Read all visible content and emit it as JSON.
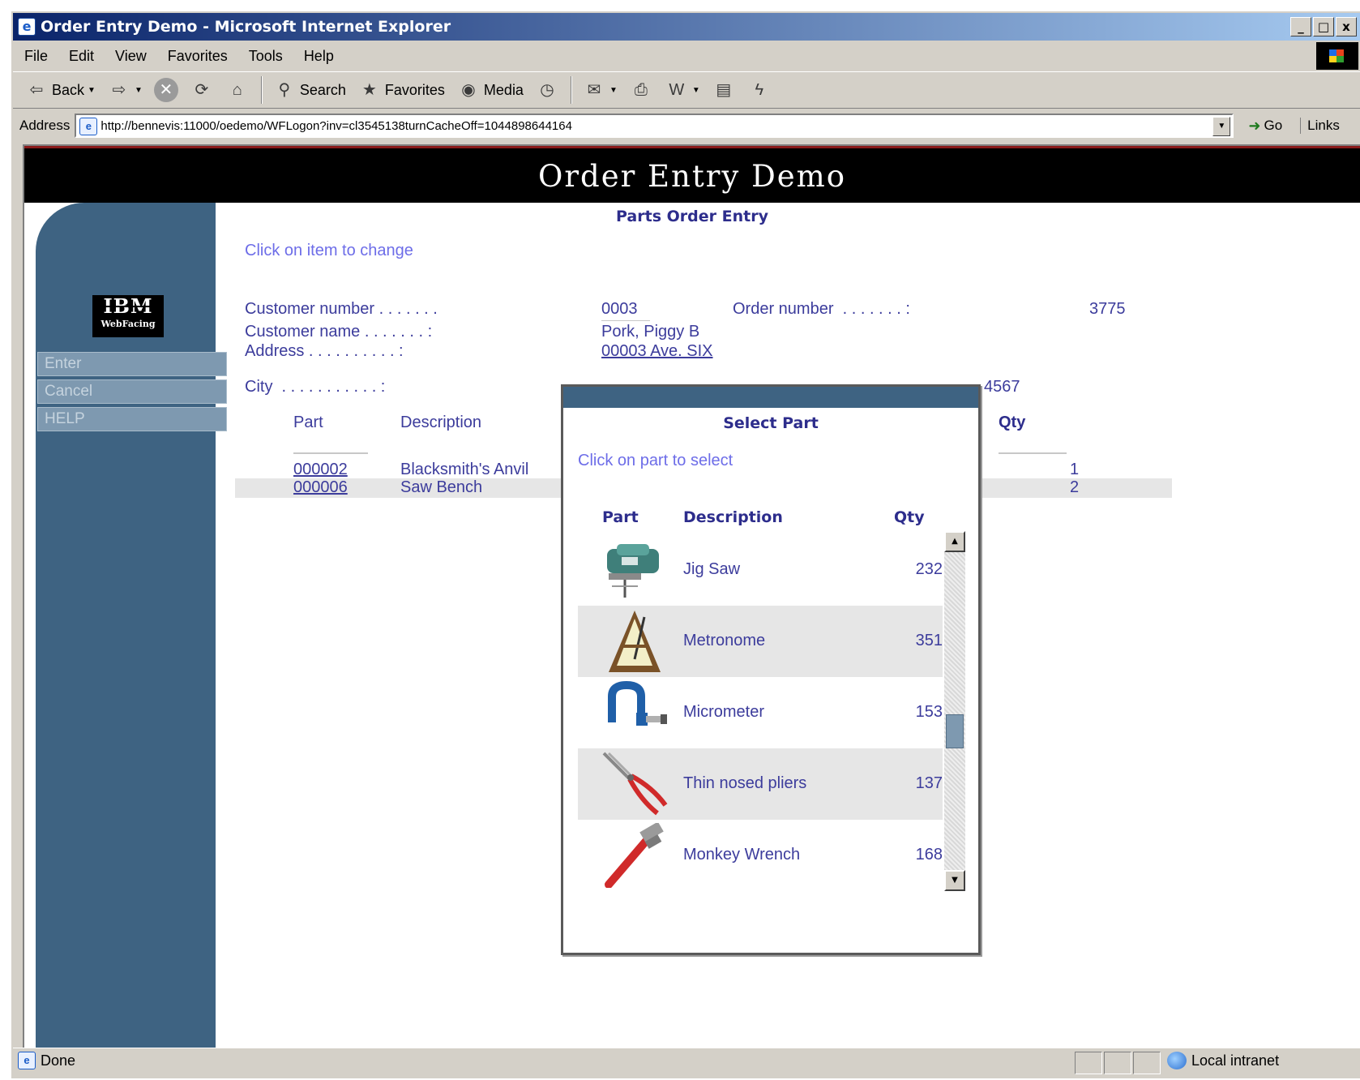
{
  "window": {
    "title": "Order Entry Demo - Microsoft Internet Explorer",
    "controls": [
      "_",
      "□",
      "x"
    ]
  },
  "menu": [
    "File",
    "Edit",
    "View",
    "Favorites",
    "Tools",
    "Help"
  ],
  "toolbar": {
    "back": "Back",
    "search": "Search",
    "favorites": "Favorites",
    "media": "Media"
  },
  "address": {
    "label": "Address",
    "url": "http://bennevis:11000/oedemo/WFLogon?inv=cl3545138turnCacheOff=1044898644164",
    "go": "Go",
    "links": "Links"
  },
  "page": {
    "banner": "Order Entry Demo",
    "title": "Parts Order Entry",
    "hint": "Click on item to change"
  },
  "sidebar": {
    "logo_main": "IBM",
    "logo_sub": "WebFacing",
    "buttons": [
      "Enter",
      "Cancel",
      "HELP"
    ]
  },
  "order": {
    "customer_number_label": "Customer number . . . . . . .",
    "customer_number": "0003",
    "order_number_label": "Order number  . . . . . . . :",
    "order_number": "3775",
    "customer_name_label": "Customer name . . . . . . . :",
    "customer_name": "Pork, Piggy B",
    "address_label": "Address . . . . . . . . . . :",
    "address": "00003 Ave. SIX",
    "city_label": "City  . . . . . . . . . . . :",
    "city_partial": "4567"
  },
  "items_table": {
    "headers": {
      "part": "Part",
      "description": "Description",
      "qty": "Qty"
    },
    "rows": [
      {
        "part": "000002",
        "description": "Blacksmith's Anvil",
        "qty": "1"
      },
      {
        "part": "000006",
        "description": "Saw Bench",
        "qty": "2"
      }
    ]
  },
  "popup": {
    "title": "Select Part",
    "hint": "Click on part to select",
    "headers": {
      "part": "Part",
      "description": "Description",
      "qty": "Qty"
    },
    "parts": [
      {
        "icon": "jig-saw-icon",
        "description": "Jig Saw",
        "qty": "232"
      },
      {
        "icon": "metronome-icon",
        "description": "Metronome",
        "qty": "351"
      },
      {
        "icon": "micrometer-icon",
        "description": "Micrometer",
        "qty": "153"
      },
      {
        "icon": "pliers-icon",
        "description": "Thin nosed pliers",
        "qty": "137"
      },
      {
        "icon": "wrench-icon",
        "description": "Monkey Wrench",
        "qty": "168"
      }
    ]
  },
  "status": {
    "left": "Done",
    "zone": "Local intranet"
  }
}
